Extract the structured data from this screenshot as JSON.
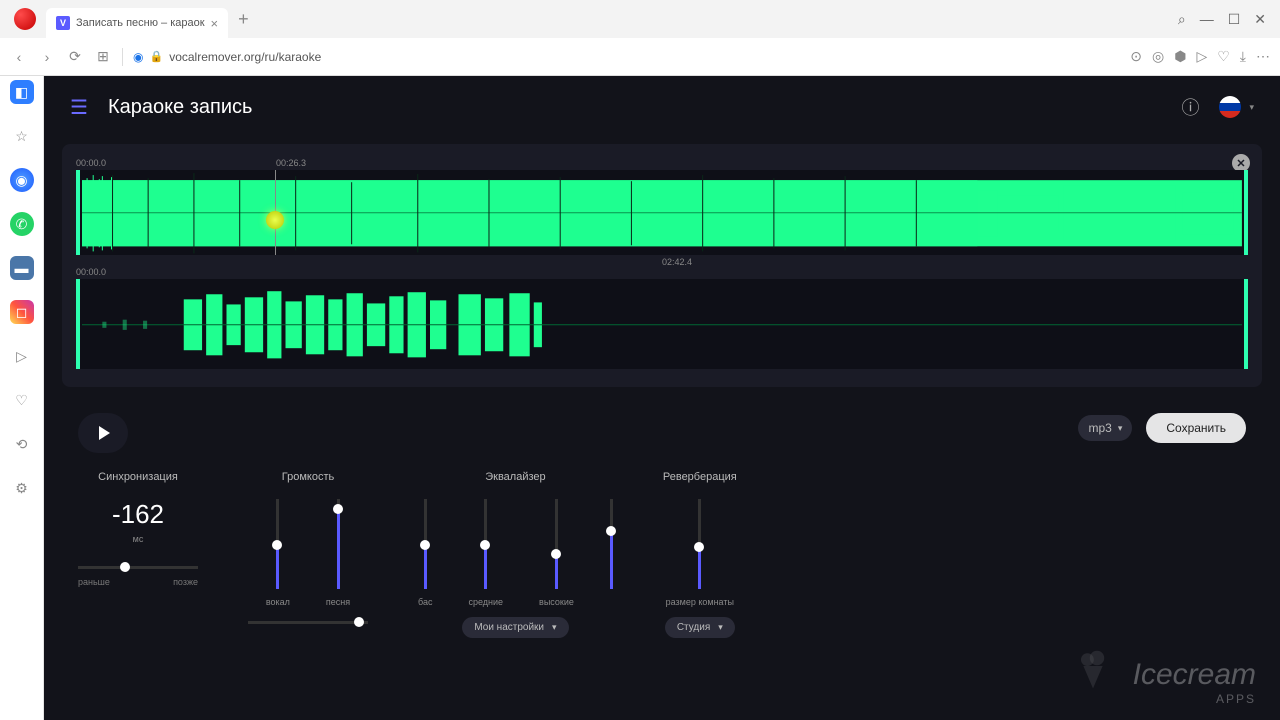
{
  "browser": {
    "tab_title": "Записать песню – караок",
    "url": "vocalremover.org/ru/karaoke",
    "search_icon": "⌕"
  },
  "header": {
    "title": "Караоке запись"
  },
  "tracks": {
    "t1_start": "00:00.0",
    "t1_marker": "00:26.3",
    "t1_mid": "02:42.4",
    "t2_start": "00:00.0"
  },
  "controls": {
    "format": "mp3",
    "save": "Сохранить"
  },
  "sliders": {
    "sync": {
      "title": "Синхронизация",
      "value": "-162",
      "unit": "мс",
      "left": "раньше",
      "right": "позже"
    },
    "volume": {
      "title": "Громкость",
      "labels": [
        "вокал",
        "песня"
      ]
    },
    "eq": {
      "title": "Эквалайзер",
      "labels": [
        "бас",
        "средние",
        "высокие"
      ],
      "preset": "Мои настройки"
    },
    "reverb": {
      "title": "Реверберация",
      "label": "размер комнаты",
      "preset": "Студия"
    }
  },
  "watermark": {
    "brand": "Icecream",
    "sub": "APPS"
  }
}
